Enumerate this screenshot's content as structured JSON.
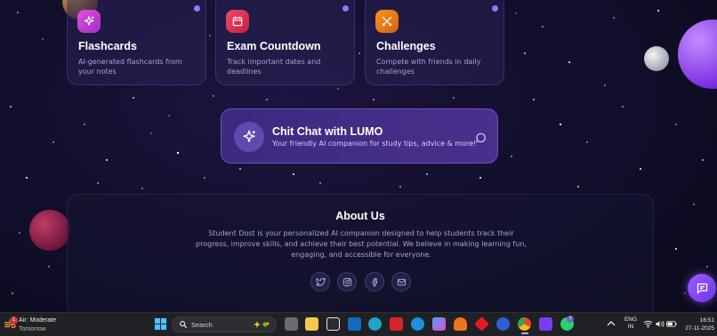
{
  "cards": [
    {
      "title": "Flashcards",
      "desc": "AI-generated flashcards from your notes",
      "icon": "sparkles-icon",
      "color": "#d946ef"
    },
    {
      "title": "Exam Countdown",
      "desc": "Track important dates and deadlines",
      "icon": "calendar-icon",
      "color": "#e11d48"
    },
    {
      "title": "Challenges",
      "desc": "Compete with friends in daily challenges",
      "icon": "crossed-swords-icon",
      "color": "#f97316"
    }
  ],
  "chat": {
    "title": "Chit Chat with LUMO",
    "subtitle": "Your friendly AI companion for study tips, advice & more!",
    "icon": "sparkles-icon"
  },
  "about": {
    "title": "About Us",
    "body": "Student Dost is your personalized AI companion designed to help students track their progress, improve skills, and achieve their best potential. We believe in making learning fun, engaging, and accessible for everyone.",
    "social": [
      "twitter-icon",
      "instagram-icon",
      "facebook-icon",
      "mail-icon"
    ]
  },
  "taskbar": {
    "weather_badge": "1",
    "weather_line1": "Air: Moderate",
    "weather_line2": "Tomorrow",
    "search_label": "Search",
    "whatsapp_badge": "7",
    "lang_line1": "ENG",
    "lang_line2": "IN",
    "time": "16:51",
    "date": "27-11-2025"
  },
  "colors": {
    "accent": "#8b5cf6",
    "background": "#120f2c",
    "taskbar": "#202124"
  }
}
